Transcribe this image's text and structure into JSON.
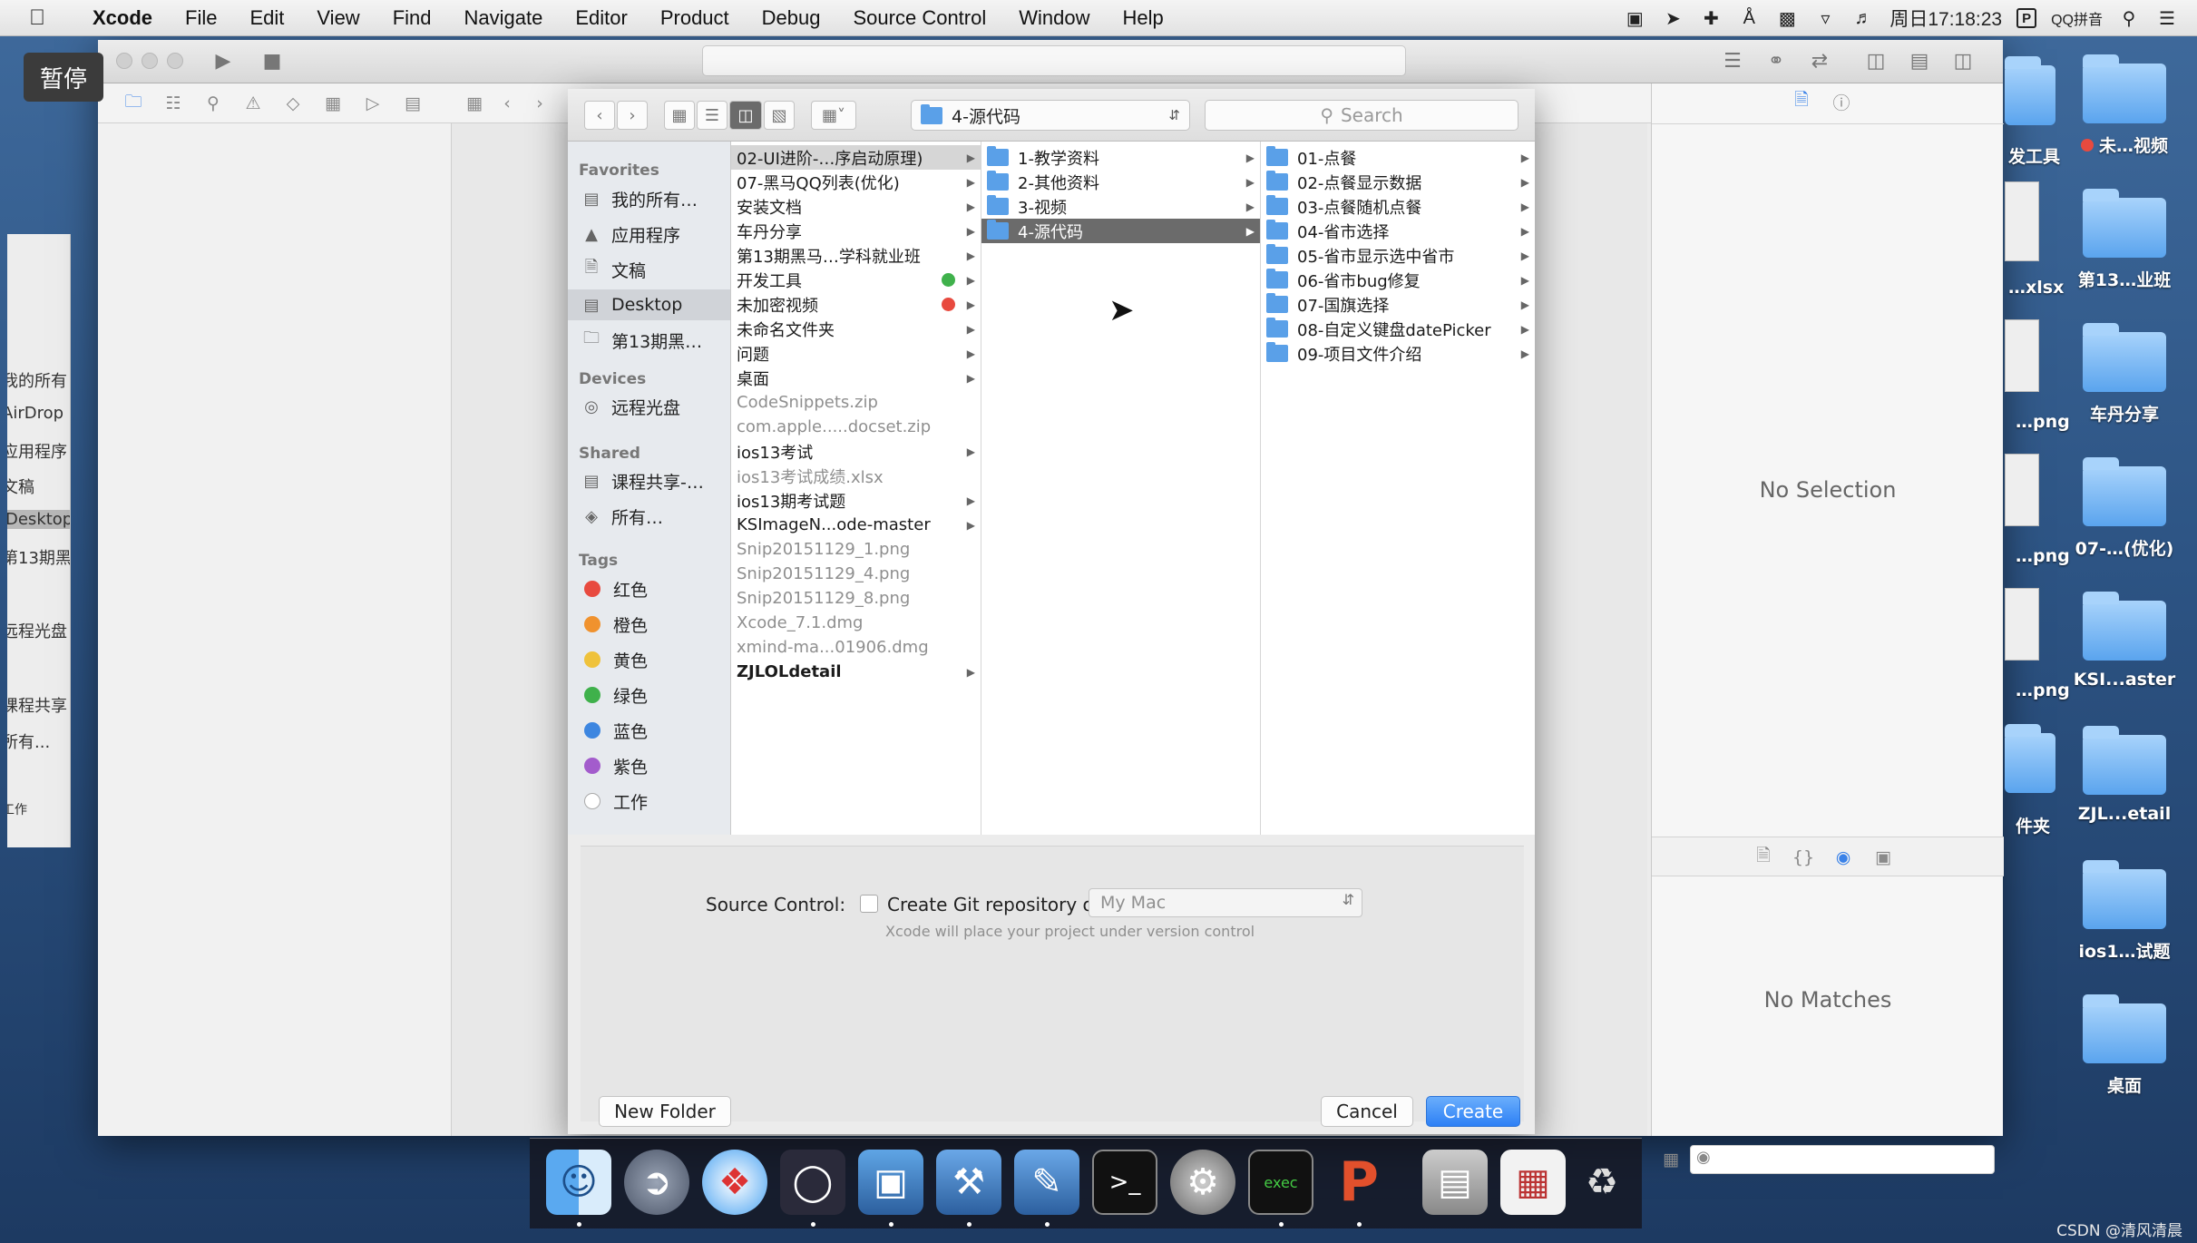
{
  "menubar": {
    "apple_icon": "apple-icon",
    "items": [
      "Xcode",
      "File",
      "Edit",
      "View",
      "Find",
      "Navigate",
      "Editor",
      "Product",
      "Debug",
      "Source Control",
      "Window",
      "Help"
    ],
    "clock": "周日17:18:23",
    "input_method": "QQ拼音",
    "status_icons": [
      "camera-icon",
      "location-icon",
      "plus-icon",
      "bluetooth-icon",
      "lock-icon",
      "wifi-icon",
      "volume-icon"
    ]
  },
  "overlay": {
    "pause_label": "暂停"
  },
  "background_window": {
    "items": [
      "我的所有",
      "AirDrop",
      "应用程序",
      "文稿",
      "Desktop",
      "第13期黑",
      "远程光盘",
      "课程共享",
      "所有...",
      "工作"
    ],
    "selected": "Desktop"
  },
  "xcode": {
    "inspector": {
      "no_selection": "No Selection",
      "no_matches": "No Matches"
    }
  },
  "dialog": {
    "path_popup": "4-源代码",
    "search_placeholder": "Search",
    "sidebar": {
      "favorites_header": "Favorites",
      "favorites": [
        "我的所有…",
        "应用程序",
        "文稿",
        "Desktop",
        "第13期黑…"
      ],
      "selected_favorite": "Desktop",
      "devices_header": "Devices",
      "devices": [
        "远程光盘"
      ],
      "shared_header": "Shared",
      "shared": [
        "课程共享-…",
        "所有…"
      ],
      "tags_header": "Tags",
      "tags": [
        {
          "label": "红色",
          "color": "#e84a3f"
        },
        {
          "label": "橙色",
          "color": "#f0922e"
        },
        {
          "label": "黄色",
          "color": "#efc23b"
        },
        {
          "label": "绿色",
          "color": "#3fb14b"
        },
        {
          "label": "蓝色",
          "color": "#3d86e0"
        },
        {
          "label": "紫色",
          "color": "#a35ccc"
        },
        {
          "label": "工作",
          "color": "#ffffff"
        }
      ]
    },
    "column1": [
      {
        "label": "02-UI进阶-…序启动原理)",
        "folder": true,
        "state": "sel"
      },
      {
        "label": "07-黑马QQ列表(优化)",
        "folder": true
      },
      {
        "label": "安装文档",
        "folder": true
      },
      {
        "label": "车丹分享",
        "folder": true
      },
      {
        "label": "第13期黑马…学科就业班",
        "folder": true
      },
      {
        "label": "开发工具",
        "folder": true,
        "dot": "#3fb14b"
      },
      {
        "label": "未加密视频",
        "folder": true,
        "dot": "#e84a3f"
      },
      {
        "label": "未命名文件夹",
        "folder": true
      },
      {
        "label": "问题",
        "folder": true
      },
      {
        "label": "桌面",
        "folder": true
      },
      {
        "label": "CodeSnippets.zip",
        "folder": false
      },
      {
        "label": "com.apple.....docset.zip",
        "folder": false
      },
      {
        "label": "ios13考试",
        "folder": true
      },
      {
        "label": "ios13考试成绩.xlsx",
        "folder": false
      },
      {
        "label": "ios13期考试题",
        "folder": true
      },
      {
        "label": "KSImageN...ode-master",
        "folder": true
      },
      {
        "label": "Snip20151129_1.png",
        "folder": false
      },
      {
        "label": "Snip20151129_4.png",
        "folder": false
      },
      {
        "label": "Snip20151129_8.png",
        "folder": false
      },
      {
        "label": "Xcode_7.1.dmg",
        "folder": false
      },
      {
        "label": "xmind-ma...01906.dmg",
        "folder": false
      },
      {
        "label": "ZJLOLdetail",
        "folder": true,
        "bold": true
      }
    ],
    "column2": [
      {
        "label": "1-教学资料"
      },
      {
        "label": "2-其他资料"
      },
      {
        "label": "3-视频"
      },
      {
        "label": "4-源代码",
        "state": "hl"
      }
    ],
    "column3": [
      {
        "label": "01-点餐"
      },
      {
        "label": "02-点餐显示数据"
      },
      {
        "label": "03-点餐随机点餐"
      },
      {
        "label": "04-省市选择"
      },
      {
        "label": "05-省市显示选中省市"
      },
      {
        "label": "06-省市bug修复"
      },
      {
        "label": "07-国旗选择"
      },
      {
        "label": "08-自定义键盘datePicker"
      },
      {
        "label": "09-项目文件介绍"
      }
    ],
    "source_control_label": "Source Control:",
    "git_checkbox_label": "Create Git repository on",
    "git_checked": false,
    "git_location": "My Mac",
    "hint": "Xcode will place your project under version control",
    "new_folder_button": "New Folder",
    "cancel_button": "Cancel",
    "create_button": "Create"
  },
  "desktop_icons": [
    {
      "label": "未…视频",
      "dot_color": "#e84a3f"
    },
    {
      "label": "第13…业班"
    },
    {
      "label": "车丹分享"
    },
    {
      "label": "07-…(优化)"
    },
    {
      "label": "KSI...aster"
    },
    {
      "label": "ZJL...etail"
    },
    {
      "label": "ios1…试题"
    },
    {
      "label": "桌面"
    }
  ],
  "desktop_partial_labels": [
    "发工具",
    "…xlsx",
    "…png",
    "…png",
    "…png",
    "件夹"
  ],
  "dock_icons": [
    "finder-icon",
    "launchpad-icon",
    "safari-icon",
    "mouse-icon",
    "keynote-icon",
    "xcode-icon",
    "sketch-icon",
    "terminal-icon",
    "system-preferences-icon",
    "console-icon",
    "powerpoint-icon",
    "screen-icon",
    "preview-icon",
    "trash-icon"
  ],
  "watermark": "CSDN @清风清晨"
}
